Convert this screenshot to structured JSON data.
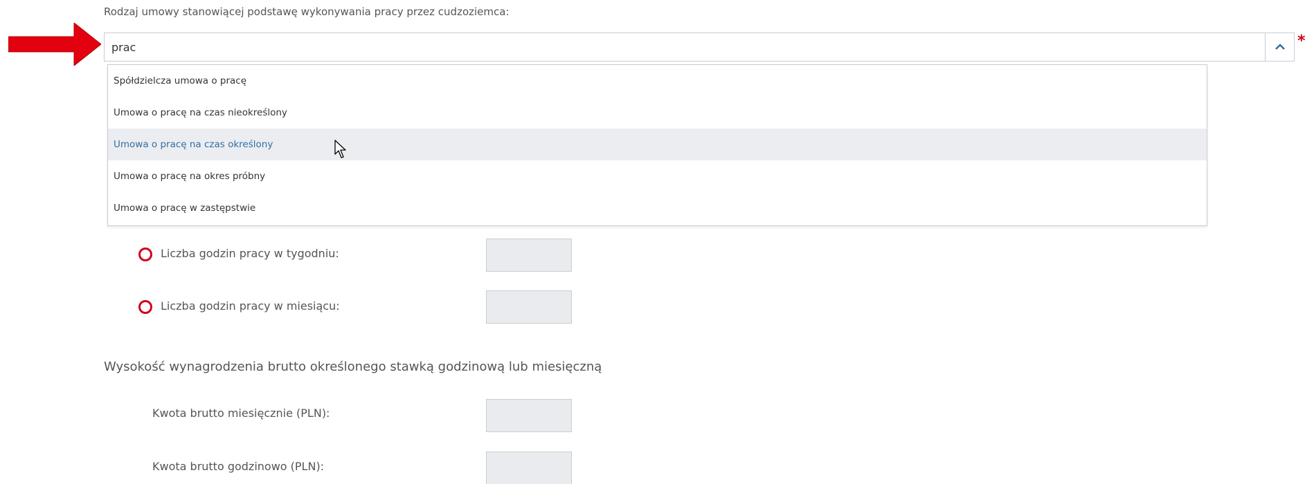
{
  "contract_type": {
    "label": "Rodzaj umowy stanowiącej podstawę wykonywania pracy przez cudzoziemca:",
    "input_value": "prac",
    "required_mark": "*",
    "options": [
      "Spółdzielcza umowa o pracę",
      "Umowa o pracę na czas nieokreślony",
      "Umowa o pracę na czas określony",
      "Umowa o pracę na okres próbny",
      "Umowa o pracę w zastępstwie"
    ],
    "hovered_option": "Umowa o pracę na czas określony"
  },
  "work_hours": {
    "weekly_label": "Liczba godzin pracy w tygodniu:",
    "weekly_value": "",
    "monthly_label": "Liczba godzin pracy w miesiącu:",
    "monthly_value": ""
  },
  "salary": {
    "heading": "Wysokość wynagrodzenia brutto określonego stawką godzinową lub miesięczną",
    "monthly_label": "Kwota brutto miesięcznie (PLN):",
    "monthly_value": "",
    "hourly_label": "Kwota brutto godzinowo (PLN):",
    "hourly_value": ""
  },
  "colors": {
    "annotation_arrow": "#e3000f",
    "required": "#d0021b",
    "highlight_text": "#2f6fa6",
    "highlight_bg": "#ebedf1",
    "input_bg": "#e9ebee"
  },
  "icons": {
    "toggle": "chevron-up-icon",
    "annotation": "red-arrow-icon",
    "status": "red-circle-icon",
    "pointer": "mouse-cursor-icon"
  }
}
